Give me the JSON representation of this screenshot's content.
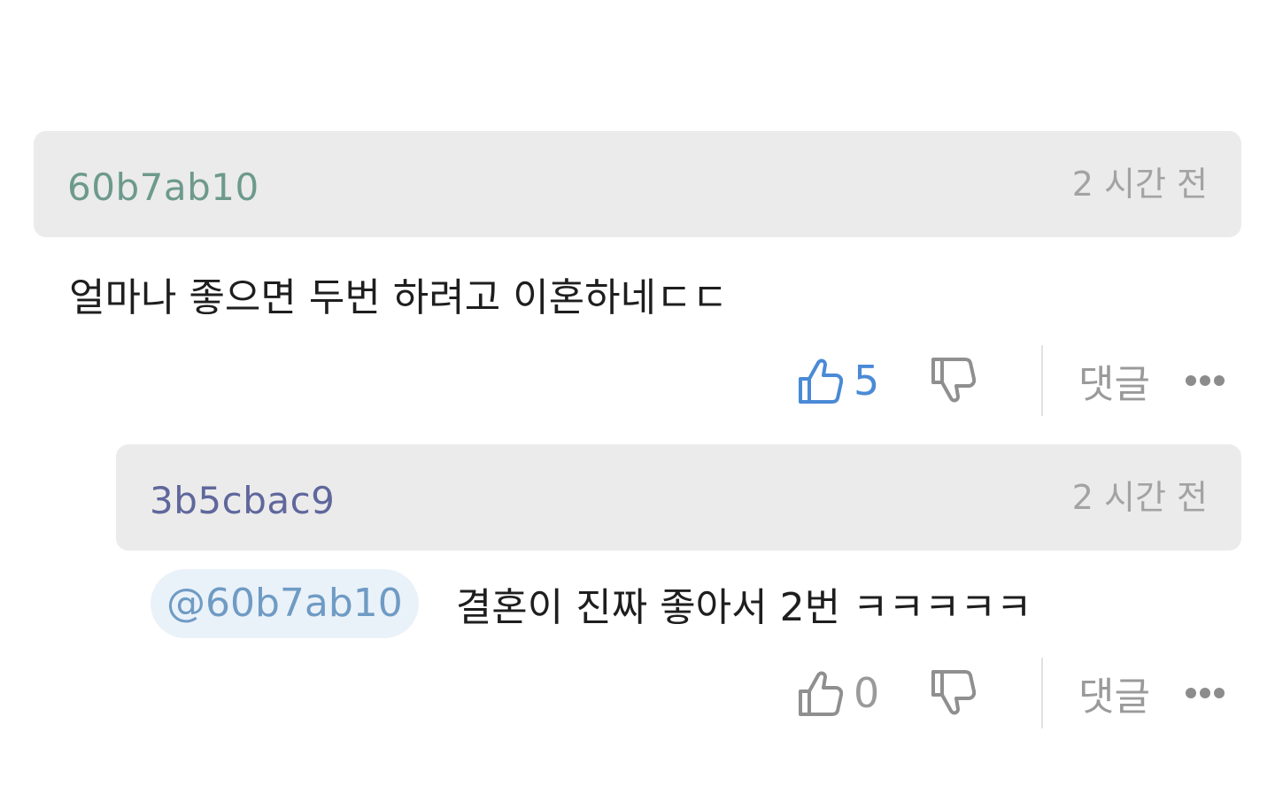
{
  "comments": [
    {
      "username": "60b7ab10",
      "timestamp": "2 시간 전",
      "body": "얼마나 좋으면 두번 하려고 이혼하네ㄷㄷ",
      "likes": "5",
      "reply_label": "댓글",
      "liked": true
    },
    {
      "username": "3b5cbac9",
      "timestamp": "2 시간 전",
      "mention": "@60b7ab10",
      "body": "결혼이 진짜 좋아서 2번 ㅋㅋㅋㅋㅋ",
      "likes": "0",
      "reply_label": "댓글",
      "liked": false
    }
  ],
  "colors": {
    "header_bg": "#ebebeb",
    "username1": "#6d9a8c",
    "username2": "#5f679c",
    "like_active": "#4a8ad6",
    "icon_gray": "#9a9a9a",
    "mention_bg": "#eaf2f9",
    "mention_text": "#6f9bc4"
  },
  "icons": {
    "like": "thumbs-up-icon",
    "dislike": "thumbs-down-icon",
    "more": "more-dots-icon"
  }
}
